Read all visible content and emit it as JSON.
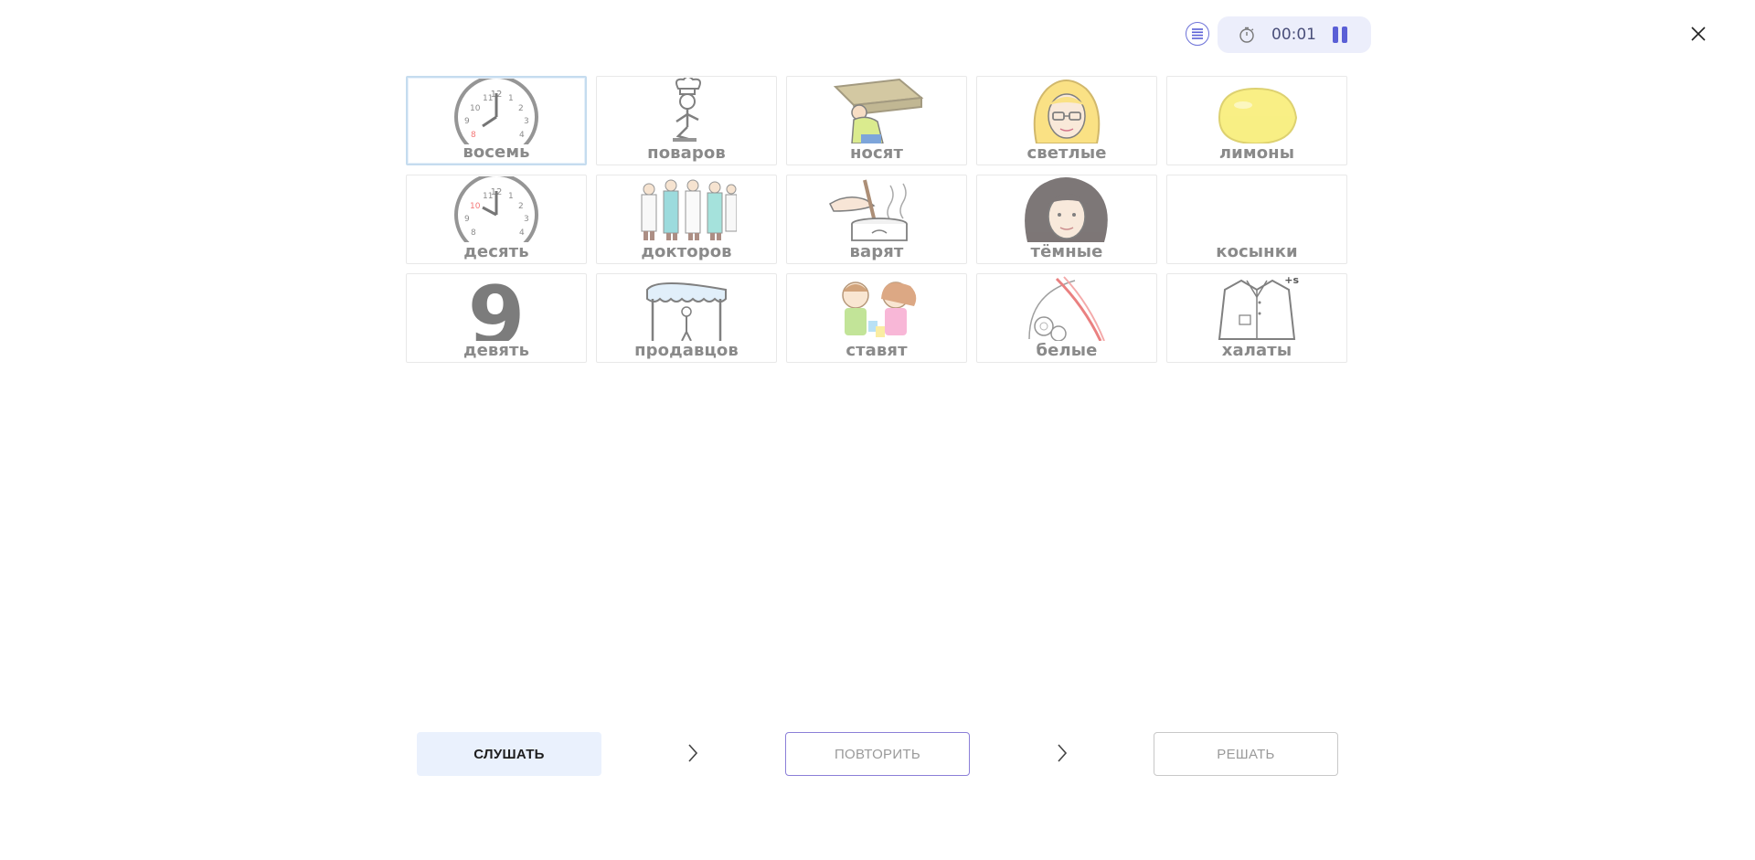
{
  "header": {
    "menu_icon": "list-icon",
    "timer_icon": "stopwatch-icon",
    "timer_value": "00:01",
    "pause_icon": "pause-icon",
    "close_icon": "close-icon",
    "accent_color": "#5a5fd6"
  },
  "cards": [
    {
      "word": "восемь",
      "icon": "clock-eight-icon"
    },
    {
      "word": "поваров",
      "icon": "chef-icon"
    },
    {
      "word": "носят",
      "icon": "person-carrying-box-icon"
    },
    {
      "word": "светлые",
      "icon": "blonde-woman-icon"
    },
    {
      "word": "лимоны",
      "icon": "lemon-icon"
    },
    {
      "word": "десять",
      "icon": "clock-ten-icon"
    },
    {
      "word": "докторов",
      "icon": "doctors-icon"
    },
    {
      "word": "варят",
      "icon": "cooking-pot-icon"
    },
    {
      "word": "тёмные",
      "icon": "dark-hair-woman-icon"
    },
    {
      "word": "косынки",
      "icon": "blank-image"
    },
    {
      "word": "девять",
      "icon": "number-nine-icon"
    },
    {
      "word": "продавцов",
      "icon": "shop-seller-icon"
    },
    {
      "word": "ставят",
      "icon": "children-placing-cups-icon"
    },
    {
      "word": "белые",
      "icon": "white-blood-cells-icon"
    },
    {
      "word": "халаты",
      "icon": "lab-coat-icon",
      "badge": "+s"
    }
  ],
  "selected_index": 0,
  "footer": {
    "listen_label": "СЛУШАТЬ",
    "repeat_label": "ПОВТОРИТЬ",
    "solve_label": "РЕШАТЬ",
    "arrow_icon": "chevron-right-icon"
  }
}
